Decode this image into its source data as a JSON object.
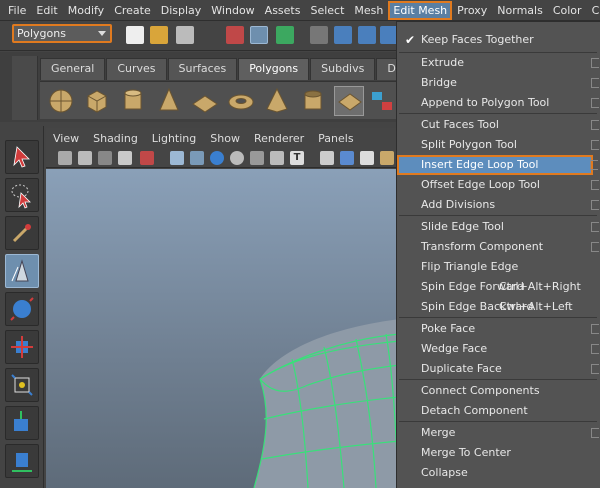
{
  "menubar": {
    "items": [
      "File",
      "Edit",
      "Modify",
      "Create",
      "Display",
      "Window",
      "Assets",
      "Select",
      "Mesh",
      "Edit Mesh",
      "Proxy",
      "Normals",
      "Color",
      "C"
    ]
  },
  "status_line": {
    "mode_value": "Polygons"
  },
  "shelf": {
    "tabs": [
      "General",
      "Curves",
      "Surfaces",
      "Polygons",
      "Subdivs",
      "Defo"
    ],
    "active_tab": "Polygons"
  },
  "panel": {
    "menu": [
      "View",
      "Shading",
      "Lighting",
      "Show",
      "Renderer",
      "Panels"
    ]
  },
  "edit_mesh_menu": {
    "items": [
      {
        "label": "Keep Faces Together",
        "checked": true
      },
      {
        "label": "Extrude",
        "option": true
      },
      {
        "label": "Bridge",
        "option": true
      },
      {
        "label": "Append to Polygon Tool",
        "option": true
      },
      {
        "label": "Cut Faces Tool",
        "option": true
      },
      {
        "label": "Split Polygon Tool",
        "option": true
      },
      {
        "label": "Insert Edge Loop Tool",
        "option": true,
        "highlighted": true
      },
      {
        "label": "Offset Edge Loop Tool",
        "option": true
      },
      {
        "label": "Add Divisions",
        "option": true
      },
      {
        "label": "Slide Edge Tool",
        "option": true
      },
      {
        "label": "Transform Component",
        "option": true
      },
      {
        "label": "Flip Triangle Edge",
        "option": false
      },
      {
        "label": "Spin Edge Forward",
        "shortcut": "Ctrl+Alt+Right",
        "option": false
      },
      {
        "label": "Spin Edge Backward",
        "shortcut": "Ctrl+Alt+Left",
        "option": false
      },
      {
        "label": "Poke Face",
        "option": true
      },
      {
        "label": "Wedge Face",
        "option": true
      },
      {
        "label": "Duplicate Face",
        "option": true
      },
      {
        "label": "Connect Components",
        "option": false
      },
      {
        "label": "Detach Component",
        "option": false
      },
      {
        "label": "Merge",
        "option": true
      },
      {
        "label": "Merge To Center",
        "option": false
      },
      {
        "label": "Collapse",
        "option": false
      }
    ]
  },
  "colors": {
    "highlight_outline": "#e07a1f",
    "menu_highlight": "#5d8dbd",
    "wireframe": "#39e07a"
  }
}
